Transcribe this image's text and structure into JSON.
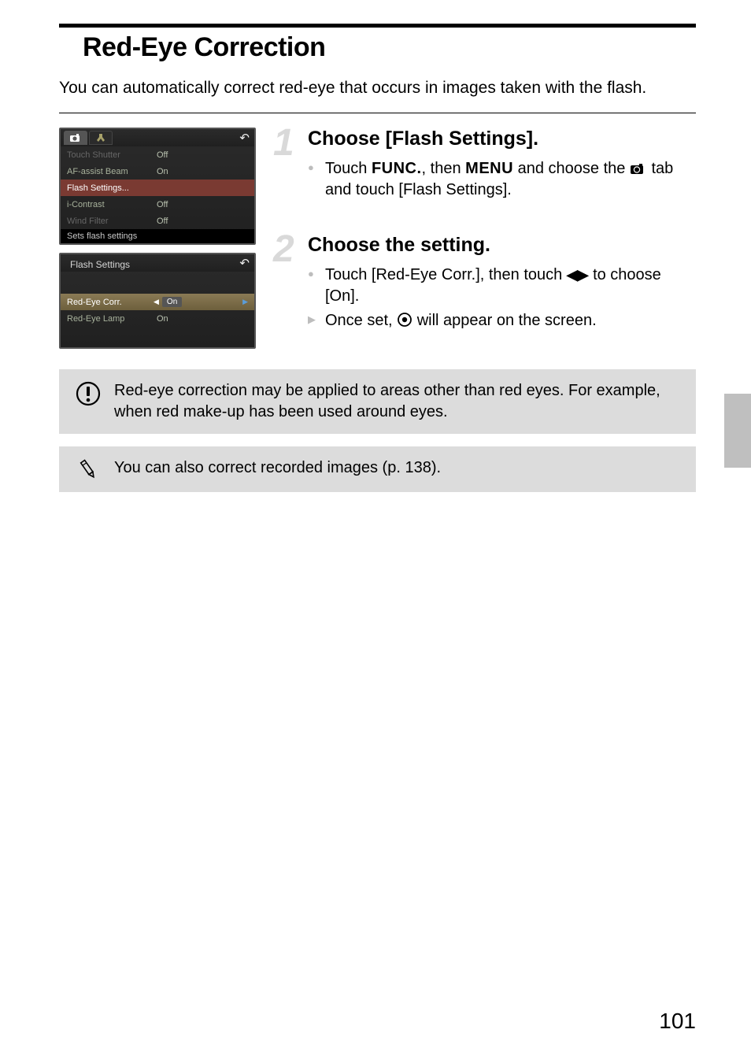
{
  "title": "Red-Eye Correction",
  "intro": "You can automatically correct red-eye that occurs in images taken with the flash.",
  "cam1": {
    "rows": [
      {
        "label": "Touch Shutter",
        "value": "Off",
        "dim": true
      },
      {
        "label": "AF-assist Beam",
        "value": "On"
      },
      {
        "label": "Flash Settings...",
        "value": "",
        "highlight": true
      },
      {
        "label": "i-Contrast",
        "value": "Off"
      },
      {
        "label": "Wind Filter",
        "value": "Off",
        "dim": true
      }
    ],
    "status": "Sets flash settings"
  },
  "cam2": {
    "title": "Flash Settings",
    "rows": [
      {
        "label": "Red-Eye Corr.",
        "value": "On",
        "select": true
      },
      {
        "label": "Red-Eye Lamp",
        "value": "On"
      }
    ]
  },
  "steps": [
    {
      "num": "1",
      "title": "Choose [Flash Settings].",
      "items": [
        {
          "type": "bullet",
          "html": "Touch <span class='inlinefunc'>FUNC.</span>, then <span class='inlinefunc'>MENU</span> and choose the <svg class='inline-icon' width='22' height='16'><rect x='1' y='3' width='16' height='11' rx='2' fill='#000'/><circle cx='9' cy='8.5' r='3.6' fill='#000' stroke='#fff' stroke-width='1.2'/><rect x='12' y='1' width='4' height='3' fill='#000'/></svg> tab and touch [Flash Settings]."
        }
      ]
    },
    {
      "num": "2",
      "title": "Choose the setting.",
      "items": [
        {
          "type": "bullet",
          "html": "Touch [Red-Eye Corr.], then touch <span class='lr-arrows'>◀▶</span> to choose [On]."
        },
        {
          "type": "result",
          "html": "Once set, <svg class='inline-icon' width='20' height='20'><circle cx='10' cy='10' r='8' fill='none' stroke='#000' stroke-width='1.8'/><circle cx='10' cy='10' r='3.2' fill='#000'/></svg> will appear on the screen."
        }
      ]
    }
  ],
  "notes": [
    {
      "icon": "warning",
      "text": "Red-eye correction may be applied to areas other than red eyes. For example, when red make-up has been used around eyes."
    },
    {
      "icon": "pencil",
      "text": "You can also correct recorded images (p. 138)."
    }
  ],
  "pageNumber": "101"
}
